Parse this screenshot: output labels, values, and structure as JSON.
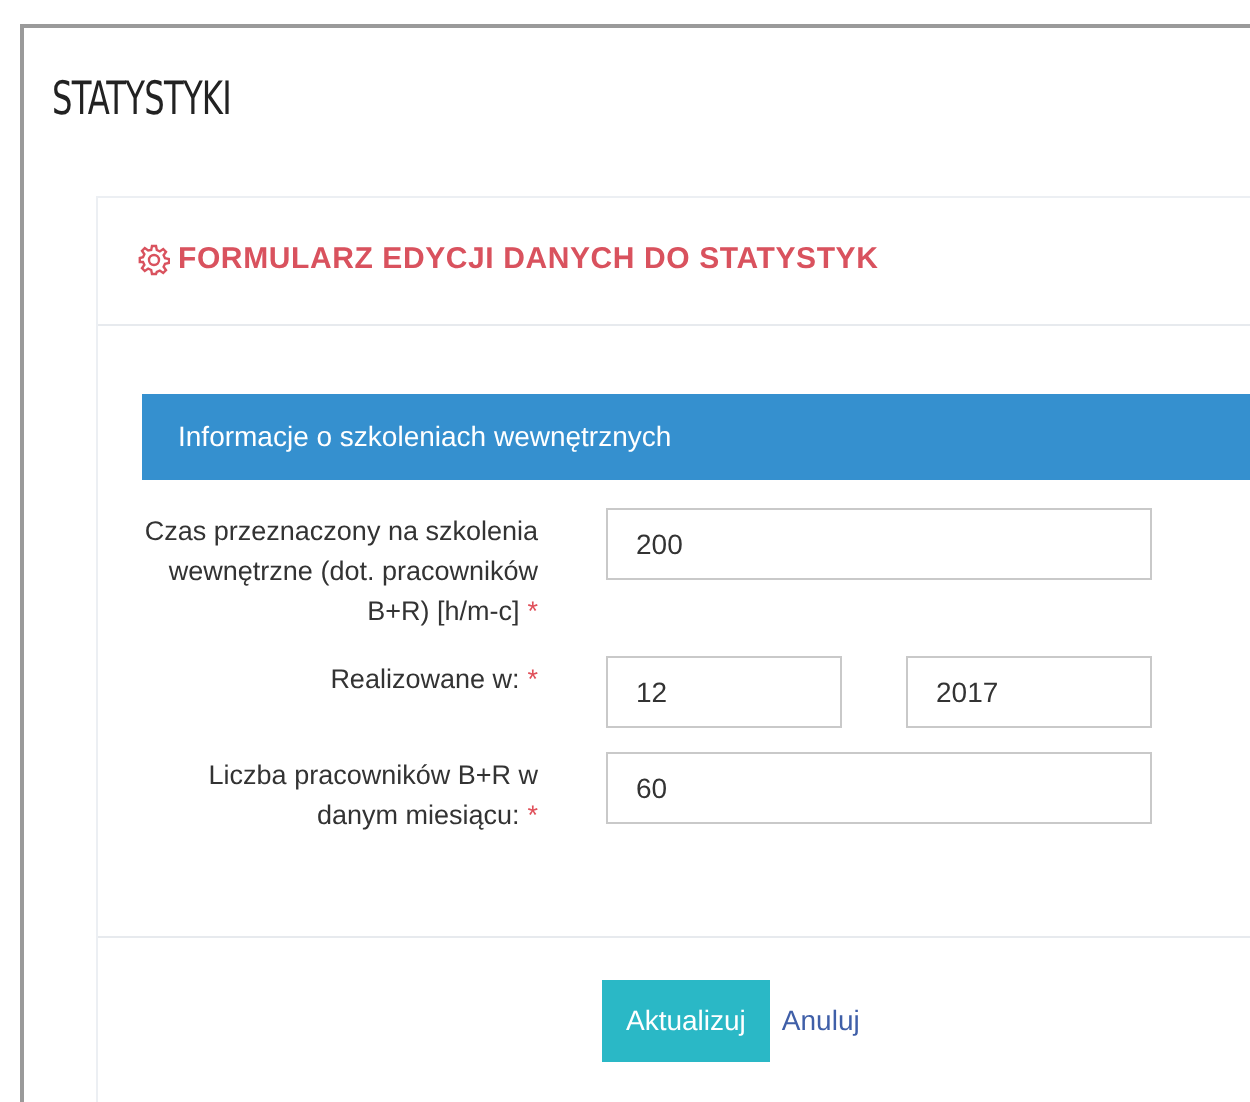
{
  "page_title": "STATYSTYKI",
  "form_title": "FORMULARZ EDYCJI DANYCH DO STATYSTYK",
  "section_title": "Informacje o szkoleniach wewnętrznych",
  "fields": [
    {
      "label": "Czas przeznaczony na szkolenia wewnętrzne (dot. pracowników B+R) [h/m-c]",
      "required_mark": "*",
      "values": [
        "200"
      ]
    },
    {
      "label": "Realizowane w:",
      "required_mark": "*",
      "values": [
        "12",
        "2017"
      ]
    },
    {
      "label": "Liczba pracowników B+R w danym miesiącu:",
      "required_mark": "*",
      "values": [
        "60"
      ]
    }
  ],
  "buttons": [
    {
      "label": "Aktualizuj",
      "kind": "primary"
    },
    {
      "label": "Anuluj",
      "kind": "link"
    }
  ]
}
